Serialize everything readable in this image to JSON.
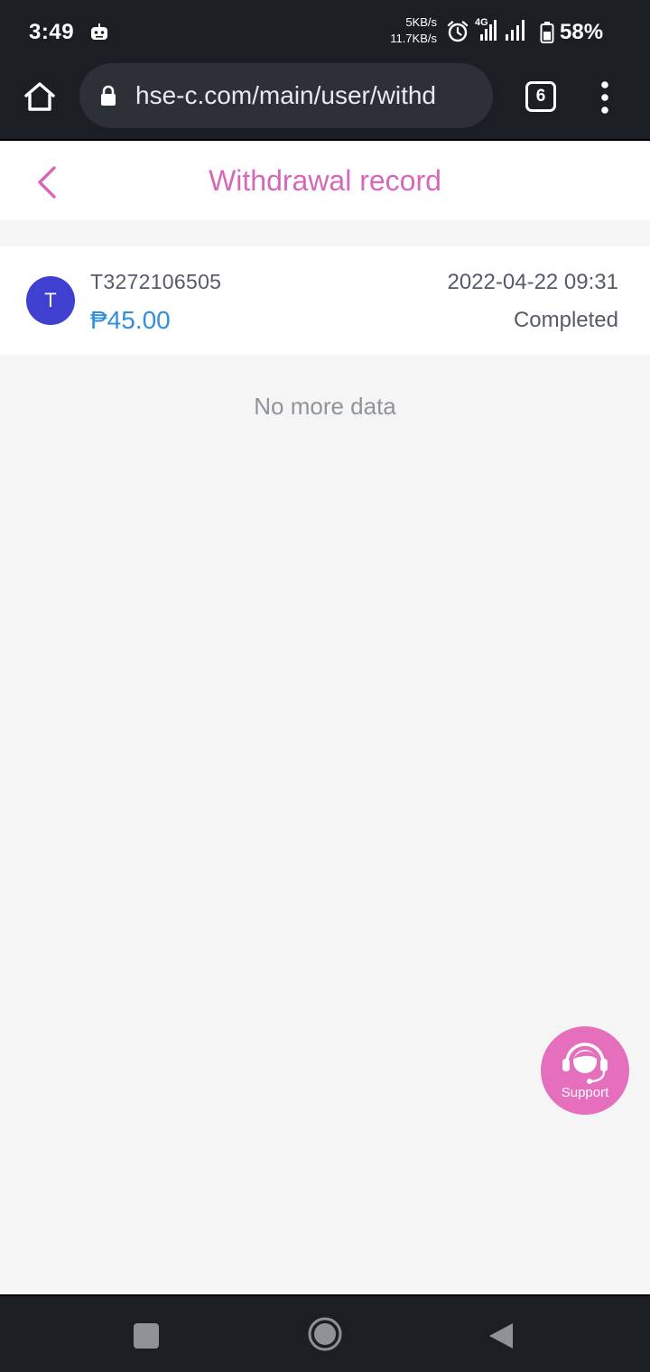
{
  "status_bar": {
    "time": "3:49",
    "net_up": "5KB/s",
    "net_down": "11.7KB/s",
    "network_type": "4G",
    "battery": "58%"
  },
  "browser": {
    "url": "hse-c.com/main/user/withd",
    "tab_count": "6"
  },
  "header": {
    "title": "Withdrawal record"
  },
  "records": [
    {
      "avatar_letter": "T",
      "id": "T3272106505",
      "amount": "₱45.00",
      "datetime": "2022-04-22 09:31",
      "status": "Completed"
    }
  ],
  "list_footer": "No more data",
  "support": {
    "label": "Support"
  },
  "colors": {
    "accent": "#d867b9",
    "amount": "#2f8fdc",
    "avatar": "#3f3fd0",
    "support": "#e56ebd"
  }
}
